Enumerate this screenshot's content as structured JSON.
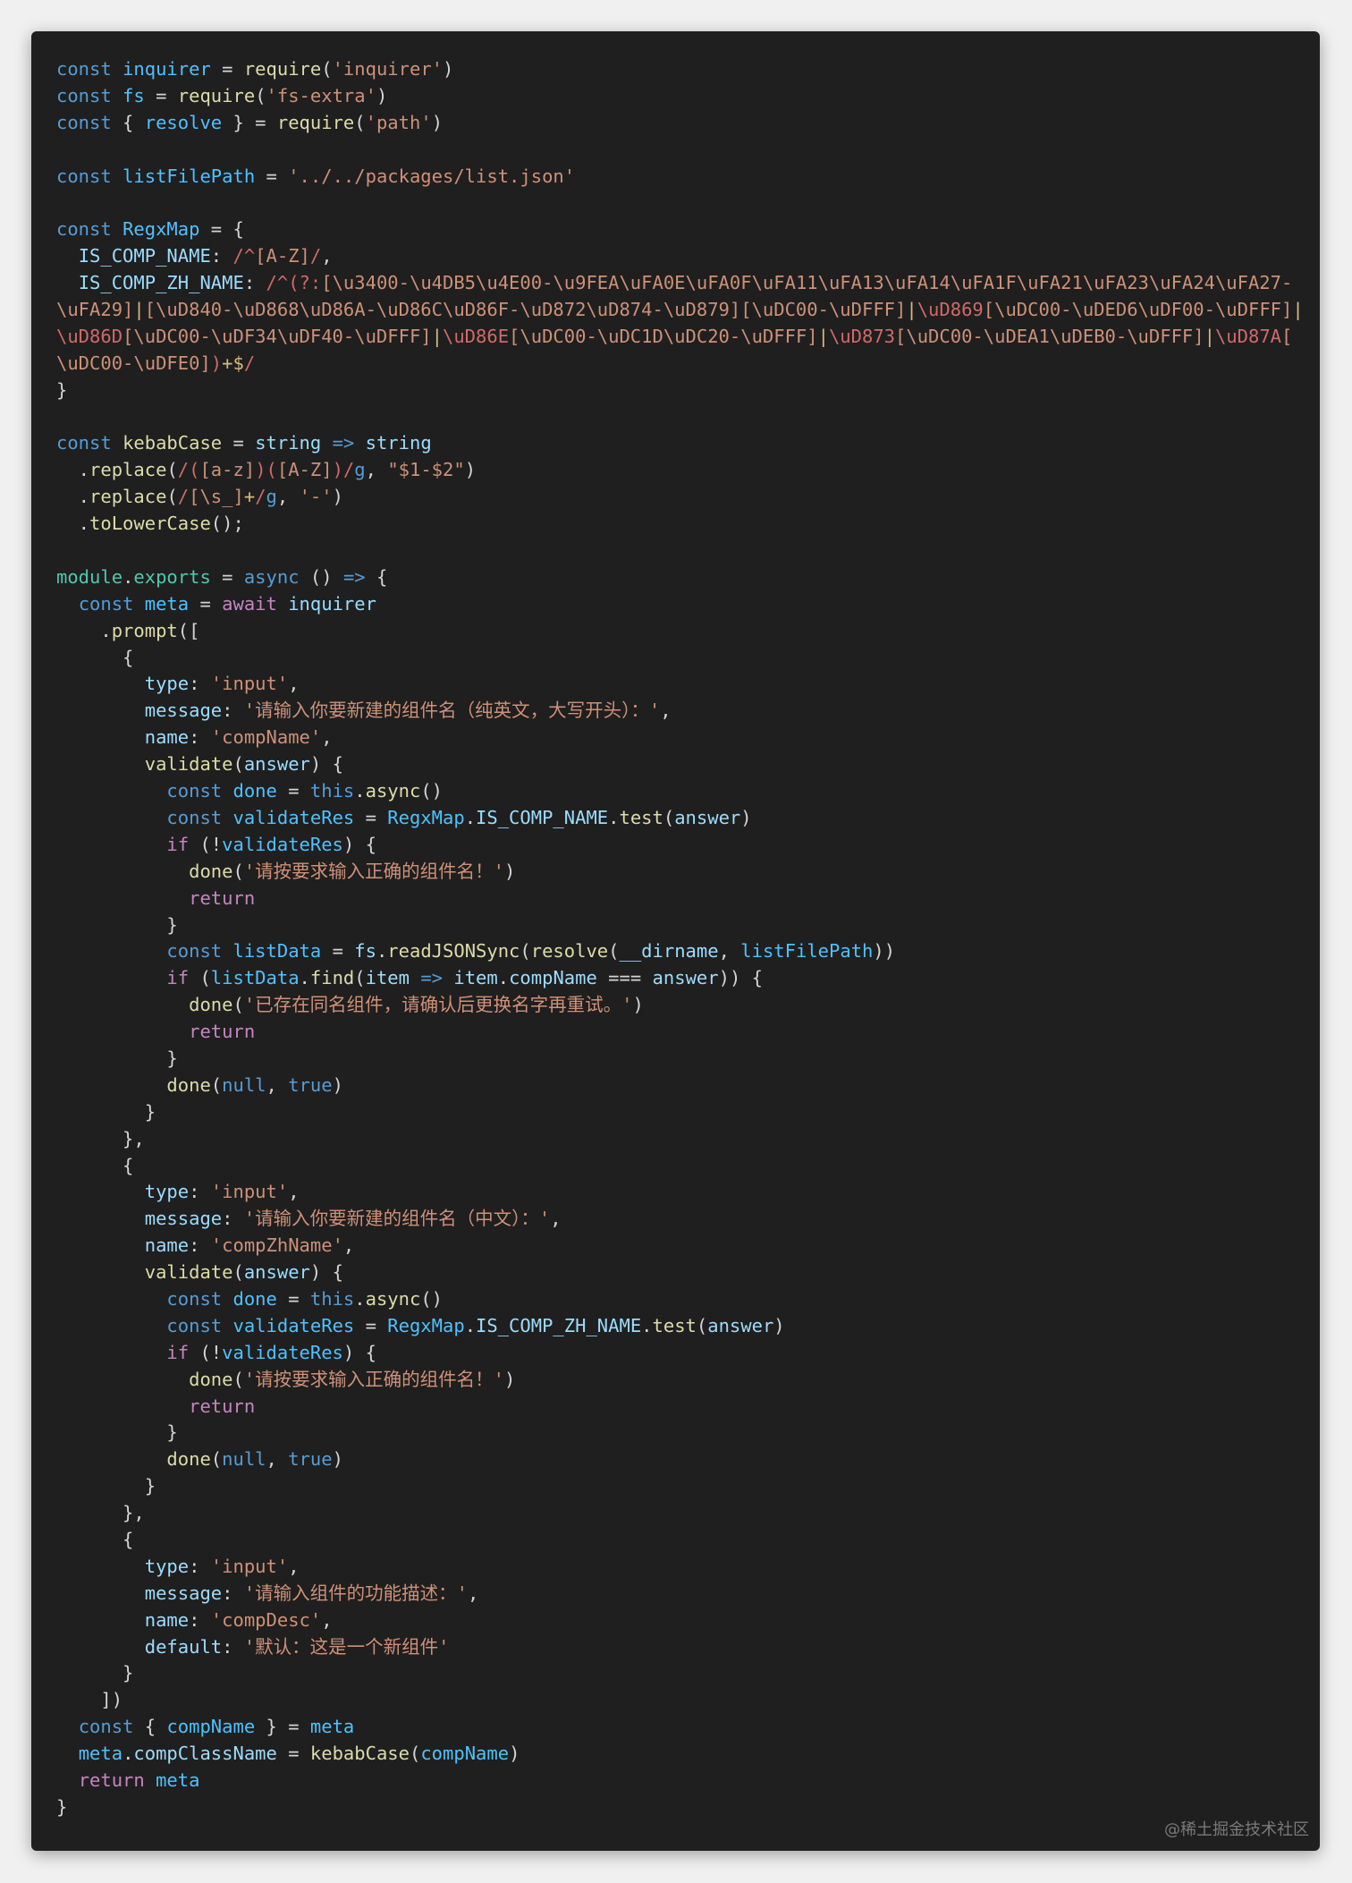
{
  "theme": {
    "background": "#1f1f1f",
    "page": "#f0f0f0",
    "colors": {
      "keyword": "#569cd6",
      "control": "#c586c0",
      "variable": "#9cdcfe",
      "constant": "#4fc1ff",
      "function": "#dcdcaa",
      "string": "#ce9178",
      "regex": "#d16969",
      "text": "#d4d4d4"
    }
  },
  "code": {
    "lines": [
      [
        [
          "k",
          "const"
        ],
        [
          "p",
          " "
        ],
        [
          "n",
          "inquirer"
        ],
        [
          "p",
          " = "
        ],
        [
          "f",
          "require"
        ],
        [
          "p",
          "("
        ],
        [
          "s",
          "'inquirer'"
        ],
        [
          "p",
          ")"
        ]
      ],
      [
        [
          "k",
          "const"
        ],
        [
          "p",
          " "
        ],
        [
          "n",
          "fs"
        ],
        [
          "p",
          " = "
        ],
        [
          "f",
          "require"
        ],
        [
          "p",
          "("
        ],
        [
          "s",
          "'fs-extra'"
        ],
        [
          "p",
          ")"
        ]
      ],
      [
        [
          "k",
          "const"
        ],
        [
          "p",
          " { "
        ],
        [
          "n",
          "resolve"
        ],
        [
          "p",
          " } = "
        ],
        [
          "f",
          "require"
        ],
        [
          "p",
          "("
        ],
        [
          "s",
          "'path'"
        ],
        [
          "p",
          ")"
        ]
      ],
      [],
      [
        [
          "k",
          "const"
        ],
        [
          "p",
          " "
        ],
        [
          "n",
          "listFilePath"
        ],
        [
          "p",
          " = "
        ],
        [
          "s",
          "'../../packages/list.json'"
        ]
      ],
      [],
      [
        [
          "k",
          "const"
        ],
        [
          "p",
          " "
        ],
        [
          "n",
          "RegxMap"
        ],
        [
          "p",
          " = {"
        ]
      ],
      [
        [
          "p",
          "  "
        ],
        [
          "v",
          "IS_COMP_NAME"
        ],
        [
          "p",
          ": "
        ],
        [
          "r",
          "/^"
        ],
        [
          "rb",
          "[A-Z]"
        ],
        [
          "r",
          "/"
        ],
        [
          "p",
          ","
        ]
      ],
      [
        [
          "p",
          "  "
        ],
        [
          "v",
          "IS_COMP_ZH_NAME"
        ],
        [
          "p",
          ": "
        ],
        [
          "r",
          "/^(?:"
        ],
        [
          "rb",
          "[\\u3400-\\u4DB5\\u4E00-\\u9FEA\\uFA0E\\uFA0F\\uFA11\\uFA13\\uFA14\\uFA1F\\uFA21\\uFA23\\uFA24\\uFA27-"
        ]
      ],
      [
        [
          "rb",
          "\\uFA29]"
        ],
        [
          "g",
          "|"
        ],
        [
          "rb",
          "[\\uD840-\\uD868\\uD86A-\\uD86C\\uD86F-\\uD872\\uD874-\\uD879][\\uDC00-\\uDFFF]"
        ],
        [
          "g",
          "|"
        ],
        [
          "r",
          "\\uD869"
        ],
        [
          "rb",
          "[\\uDC00-\\uDED6\\uDF00-\\uDFFF]"
        ],
        [
          "g",
          "|"
        ]
      ],
      [
        [
          "r",
          "\\uD86D"
        ],
        [
          "rb",
          "[\\uDC00-\\uDF34\\uDF40-\\uDFFF]"
        ],
        [
          "g",
          "|"
        ],
        [
          "r",
          "\\uD86E"
        ],
        [
          "rb",
          "[\\uDC00-\\uDC1D\\uDC20-\\uDFFF]"
        ],
        [
          "g",
          "|"
        ],
        [
          "r",
          "\\uD873"
        ],
        [
          "rb",
          "[\\uDC00-\\uDEA1\\uDEB0-\\uDFFF]"
        ],
        [
          "g",
          "|"
        ],
        [
          "r",
          "\\uD87A"
        ],
        [
          "rb",
          "["
        ]
      ],
      [
        [
          "rb",
          "\\uDC00-\\uDFE0]"
        ],
        [
          "r",
          ")"
        ],
        [
          "g",
          "+$"
        ],
        [
          "r",
          "/"
        ]
      ],
      [
        [
          "p",
          "}"
        ]
      ],
      [],
      [
        [
          "k",
          "const"
        ],
        [
          "p",
          " "
        ],
        [
          "f",
          "kebabCase"
        ],
        [
          "p",
          " = "
        ],
        [
          "v",
          "string"
        ],
        [
          "p",
          " "
        ],
        [
          "k",
          "=>"
        ],
        [
          "p",
          " "
        ],
        [
          "v",
          "string"
        ]
      ],
      [
        [
          "p",
          "  ."
        ],
        [
          "f",
          "replace"
        ],
        [
          "p",
          "("
        ],
        [
          "r",
          "/("
        ],
        [
          "rb",
          "[a-z]"
        ],
        [
          "r",
          ")("
        ],
        [
          "rb",
          "[A-Z]"
        ],
        [
          "r",
          ")/"
        ],
        [
          "k",
          "g"
        ],
        [
          "p",
          ", "
        ],
        [
          "s",
          "\"$1-$2\""
        ],
        [
          "p",
          ")"
        ]
      ],
      [
        [
          "p",
          "  ."
        ],
        [
          "f",
          "replace"
        ],
        [
          "p",
          "("
        ],
        [
          "r",
          "/"
        ],
        [
          "rb",
          "[\\s_]"
        ],
        [
          "g",
          "+"
        ],
        [
          "r",
          "/"
        ],
        [
          "k",
          "g"
        ],
        [
          "p",
          ", "
        ],
        [
          "s",
          "'-'"
        ],
        [
          "p",
          ")"
        ]
      ],
      [
        [
          "p",
          "  ."
        ],
        [
          "f",
          "toLowerCase"
        ],
        [
          "p",
          "();"
        ]
      ],
      [],
      [
        [
          "t",
          "module"
        ],
        [
          "p",
          "."
        ],
        [
          "t",
          "exports"
        ],
        [
          "p",
          " = "
        ],
        [
          "k",
          "async"
        ],
        [
          "p",
          " () "
        ],
        [
          "k",
          "=>"
        ],
        [
          "p",
          " {"
        ]
      ],
      [
        [
          "p",
          "  "
        ],
        [
          "k",
          "const"
        ],
        [
          "p",
          " "
        ],
        [
          "n",
          "meta"
        ],
        [
          "p",
          " = "
        ],
        [
          "c",
          "await"
        ],
        [
          "p",
          " "
        ],
        [
          "v",
          "inquirer"
        ]
      ],
      [
        [
          "p",
          "    ."
        ],
        [
          "f",
          "prompt"
        ],
        [
          "p",
          "(["
        ]
      ],
      [
        [
          "p",
          "      {"
        ]
      ],
      [
        [
          "p",
          "        "
        ],
        [
          "v",
          "type"
        ],
        [
          "p",
          ": "
        ],
        [
          "s",
          "'input'"
        ],
        [
          "p",
          ","
        ]
      ],
      [
        [
          "p",
          "        "
        ],
        [
          "v",
          "message"
        ],
        [
          "p",
          ": "
        ],
        [
          "s",
          "'请输入你要新建的组件名（纯英文，大写开头）：'"
        ],
        [
          "p",
          ","
        ]
      ],
      [
        [
          "p",
          "        "
        ],
        [
          "v",
          "name"
        ],
        [
          "p",
          ": "
        ],
        [
          "s",
          "'compName'"
        ],
        [
          "p",
          ","
        ]
      ],
      [
        [
          "p",
          "        "
        ],
        [
          "f",
          "validate"
        ],
        [
          "p",
          "("
        ],
        [
          "v",
          "answer"
        ],
        [
          "p",
          ") {"
        ]
      ],
      [
        [
          "p",
          "          "
        ],
        [
          "k",
          "const"
        ],
        [
          "p",
          " "
        ],
        [
          "n",
          "done"
        ],
        [
          "p",
          " = "
        ],
        [
          "k",
          "this"
        ],
        [
          "p",
          "."
        ],
        [
          "f",
          "async"
        ],
        [
          "p",
          "()"
        ]
      ],
      [
        [
          "p",
          "          "
        ],
        [
          "k",
          "const"
        ],
        [
          "p",
          " "
        ],
        [
          "n",
          "validateRes"
        ],
        [
          "p",
          " = "
        ],
        [
          "n",
          "RegxMap"
        ],
        [
          "p",
          "."
        ],
        [
          "v",
          "IS_COMP_NAME"
        ],
        [
          "p",
          "."
        ],
        [
          "f",
          "test"
        ],
        [
          "p",
          "("
        ],
        [
          "v",
          "answer"
        ],
        [
          "p",
          ")"
        ]
      ],
      [
        [
          "p",
          "          "
        ],
        [
          "c",
          "if"
        ],
        [
          "p",
          " (!"
        ],
        [
          "n",
          "validateRes"
        ],
        [
          "p",
          ") {"
        ]
      ],
      [
        [
          "p",
          "            "
        ],
        [
          "f",
          "done"
        ],
        [
          "p",
          "("
        ],
        [
          "s",
          "'请按要求输入正确的组件名！'"
        ],
        [
          "p",
          ")"
        ]
      ],
      [
        [
          "p",
          "            "
        ],
        [
          "c",
          "return"
        ]
      ],
      [
        [
          "p",
          "          }"
        ]
      ],
      [
        [
          "p",
          "          "
        ],
        [
          "k",
          "const"
        ],
        [
          "p",
          " "
        ],
        [
          "n",
          "listData"
        ],
        [
          "p",
          " = "
        ],
        [
          "v",
          "fs"
        ],
        [
          "p",
          "."
        ],
        [
          "f",
          "readJSONSync"
        ],
        [
          "p",
          "("
        ],
        [
          "f",
          "resolve"
        ],
        [
          "p",
          "("
        ],
        [
          "v",
          "__dirname"
        ],
        [
          "p",
          ", "
        ],
        [
          "n",
          "listFilePath"
        ],
        [
          "p",
          "))"
        ]
      ],
      [
        [
          "p",
          "          "
        ],
        [
          "c",
          "if"
        ],
        [
          "p",
          " ("
        ],
        [
          "n",
          "listData"
        ],
        [
          "p",
          "."
        ],
        [
          "f",
          "find"
        ],
        [
          "p",
          "("
        ],
        [
          "v",
          "item"
        ],
        [
          "p",
          " "
        ],
        [
          "k",
          "=>"
        ],
        [
          "p",
          " "
        ],
        [
          "v",
          "item"
        ],
        [
          "p",
          "."
        ],
        [
          "v",
          "compName"
        ],
        [
          "p",
          " === "
        ],
        [
          "v",
          "answer"
        ],
        [
          "p",
          ")) {"
        ]
      ],
      [
        [
          "p",
          "            "
        ],
        [
          "f",
          "done"
        ],
        [
          "p",
          "("
        ],
        [
          "s",
          "'已存在同名组件，请确认后更换名字再重试。'"
        ],
        [
          "p",
          ")"
        ]
      ],
      [
        [
          "p",
          "            "
        ],
        [
          "c",
          "return"
        ]
      ],
      [
        [
          "p",
          "          }"
        ]
      ],
      [
        [
          "p",
          "          "
        ],
        [
          "f",
          "done"
        ],
        [
          "p",
          "("
        ],
        [
          "k",
          "null"
        ],
        [
          "p",
          ", "
        ],
        [
          "k",
          "true"
        ],
        [
          "p",
          ")"
        ]
      ],
      [
        [
          "p",
          "        }"
        ]
      ],
      [
        [
          "p",
          "      },"
        ]
      ],
      [
        [
          "p",
          "      {"
        ]
      ],
      [
        [
          "p",
          "        "
        ],
        [
          "v",
          "type"
        ],
        [
          "p",
          ": "
        ],
        [
          "s",
          "'input'"
        ],
        [
          "p",
          ","
        ]
      ],
      [
        [
          "p",
          "        "
        ],
        [
          "v",
          "message"
        ],
        [
          "p",
          ": "
        ],
        [
          "s",
          "'请输入你要新建的组件名（中文）：'"
        ],
        [
          "p",
          ","
        ]
      ],
      [
        [
          "p",
          "        "
        ],
        [
          "v",
          "name"
        ],
        [
          "p",
          ": "
        ],
        [
          "s",
          "'compZhName'"
        ],
        [
          "p",
          ","
        ]
      ],
      [
        [
          "p",
          "        "
        ],
        [
          "f",
          "validate"
        ],
        [
          "p",
          "("
        ],
        [
          "v",
          "answer"
        ],
        [
          "p",
          ") {"
        ]
      ],
      [
        [
          "p",
          "          "
        ],
        [
          "k",
          "const"
        ],
        [
          "p",
          " "
        ],
        [
          "n",
          "done"
        ],
        [
          "p",
          " = "
        ],
        [
          "k",
          "this"
        ],
        [
          "p",
          "."
        ],
        [
          "f",
          "async"
        ],
        [
          "p",
          "()"
        ]
      ],
      [
        [
          "p",
          "          "
        ],
        [
          "k",
          "const"
        ],
        [
          "p",
          " "
        ],
        [
          "n",
          "validateRes"
        ],
        [
          "p",
          " = "
        ],
        [
          "n",
          "RegxMap"
        ],
        [
          "p",
          "."
        ],
        [
          "v",
          "IS_COMP_ZH_NAME"
        ],
        [
          "p",
          "."
        ],
        [
          "f",
          "test"
        ],
        [
          "p",
          "("
        ],
        [
          "v",
          "answer"
        ],
        [
          "p",
          ")"
        ]
      ],
      [
        [
          "p",
          "          "
        ],
        [
          "c",
          "if"
        ],
        [
          "p",
          " (!"
        ],
        [
          "n",
          "validateRes"
        ],
        [
          "p",
          ") {"
        ]
      ],
      [
        [
          "p",
          "            "
        ],
        [
          "f",
          "done"
        ],
        [
          "p",
          "("
        ],
        [
          "s",
          "'请按要求输入正确的组件名！'"
        ],
        [
          "p",
          ")"
        ]
      ],
      [
        [
          "p",
          "            "
        ],
        [
          "c",
          "return"
        ]
      ],
      [
        [
          "p",
          "          }"
        ]
      ],
      [
        [
          "p",
          "          "
        ],
        [
          "f",
          "done"
        ],
        [
          "p",
          "("
        ],
        [
          "k",
          "null"
        ],
        [
          "p",
          ", "
        ],
        [
          "k",
          "true"
        ],
        [
          "p",
          ")"
        ]
      ],
      [
        [
          "p",
          "        }"
        ]
      ],
      [
        [
          "p",
          "      },"
        ]
      ],
      [
        [
          "p",
          "      {"
        ]
      ],
      [
        [
          "p",
          "        "
        ],
        [
          "v",
          "type"
        ],
        [
          "p",
          ": "
        ],
        [
          "s",
          "'input'"
        ],
        [
          "p",
          ","
        ]
      ],
      [
        [
          "p",
          "        "
        ],
        [
          "v",
          "message"
        ],
        [
          "p",
          ": "
        ],
        [
          "s",
          "'请输入组件的功能描述：'"
        ],
        [
          "p",
          ","
        ]
      ],
      [
        [
          "p",
          "        "
        ],
        [
          "v",
          "name"
        ],
        [
          "p",
          ": "
        ],
        [
          "s",
          "'compDesc'"
        ],
        [
          "p",
          ","
        ]
      ],
      [
        [
          "p",
          "        "
        ],
        [
          "v",
          "default"
        ],
        [
          "p",
          ": "
        ],
        [
          "s",
          "'默认：这是一个新组件'"
        ]
      ],
      [
        [
          "p",
          "      }"
        ]
      ],
      [
        [
          "p",
          "    ])"
        ]
      ],
      [
        [
          "p",
          "  "
        ],
        [
          "k",
          "const"
        ],
        [
          "p",
          " { "
        ],
        [
          "n",
          "compName"
        ],
        [
          "p",
          " } = "
        ],
        [
          "n",
          "meta"
        ]
      ],
      [
        [
          "p",
          "  "
        ],
        [
          "n",
          "meta"
        ],
        [
          "p",
          "."
        ],
        [
          "v",
          "compClassName"
        ],
        [
          "p",
          " = "
        ],
        [
          "f",
          "kebabCase"
        ],
        [
          "p",
          "("
        ],
        [
          "n",
          "compName"
        ],
        [
          "p",
          ")"
        ]
      ],
      [
        [
          "p",
          "  "
        ],
        [
          "c",
          "return"
        ],
        [
          "p",
          " "
        ],
        [
          "n",
          "meta"
        ]
      ],
      [
        [
          "p",
          "}"
        ]
      ]
    ]
  },
  "watermark": "@稀土掘金技术社区"
}
